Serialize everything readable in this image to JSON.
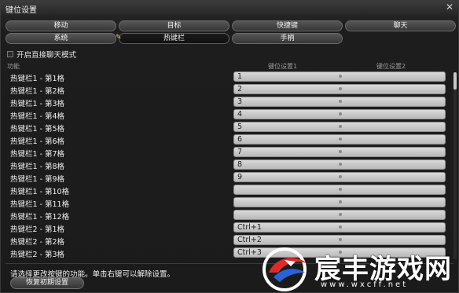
{
  "window": {
    "title": "键位设置"
  },
  "tabs_row1": [
    "移动",
    "目标",
    "快捷键",
    "聊天"
  ],
  "tabs_row2": [
    "系统",
    "热键栏",
    "手柄"
  ],
  "active_tab": "热键栏",
  "checkbox": {
    "label": "开启直接聊天模式",
    "checked": false
  },
  "columns": {
    "function": "功能",
    "key1": "键位设置1",
    "key2": "键位设置2"
  },
  "rows": [
    {
      "name": "热键栏1 - 第1格",
      "key1": "1"
    },
    {
      "name": "热键栏1 - 第2格",
      "key1": "2"
    },
    {
      "name": "热键栏1 - 第3格",
      "key1": "3"
    },
    {
      "name": "热键栏1 - 第4格",
      "key1": "4"
    },
    {
      "name": "热键栏1 - 第5格",
      "key1": "5"
    },
    {
      "name": "热键栏1 - 第6格",
      "key1": "6"
    },
    {
      "name": "热键栏1 - 第7格",
      "key1": "7"
    },
    {
      "name": "热键栏1 - 第8格",
      "key1": "8"
    },
    {
      "name": "热键栏1 - 第9格",
      "key1": "9"
    },
    {
      "name": "热键栏1 - 第10格",
      "key1": ""
    },
    {
      "name": "热键栏1 - 第11格",
      "key1": ""
    },
    {
      "name": "热键栏1 - 第12格",
      "key1": ""
    },
    {
      "name": "热键栏2 - 第1格",
      "key1": "Ctrl+1"
    },
    {
      "name": "热键栏2 - 第2格",
      "key1": "Ctrl+2"
    },
    {
      "name": "热键栏2 - 第3格",
      "key1": "Ctrl+3"
    }
  ],
  "hint": "请选择更改按键的功能。单击右键可以解除设置。",
  "reset_button": "恢复初期设置",
  "watermark": {
    "brand": "宸丰游戏网",
    "url": "www.wxcff.net"
  }
}
